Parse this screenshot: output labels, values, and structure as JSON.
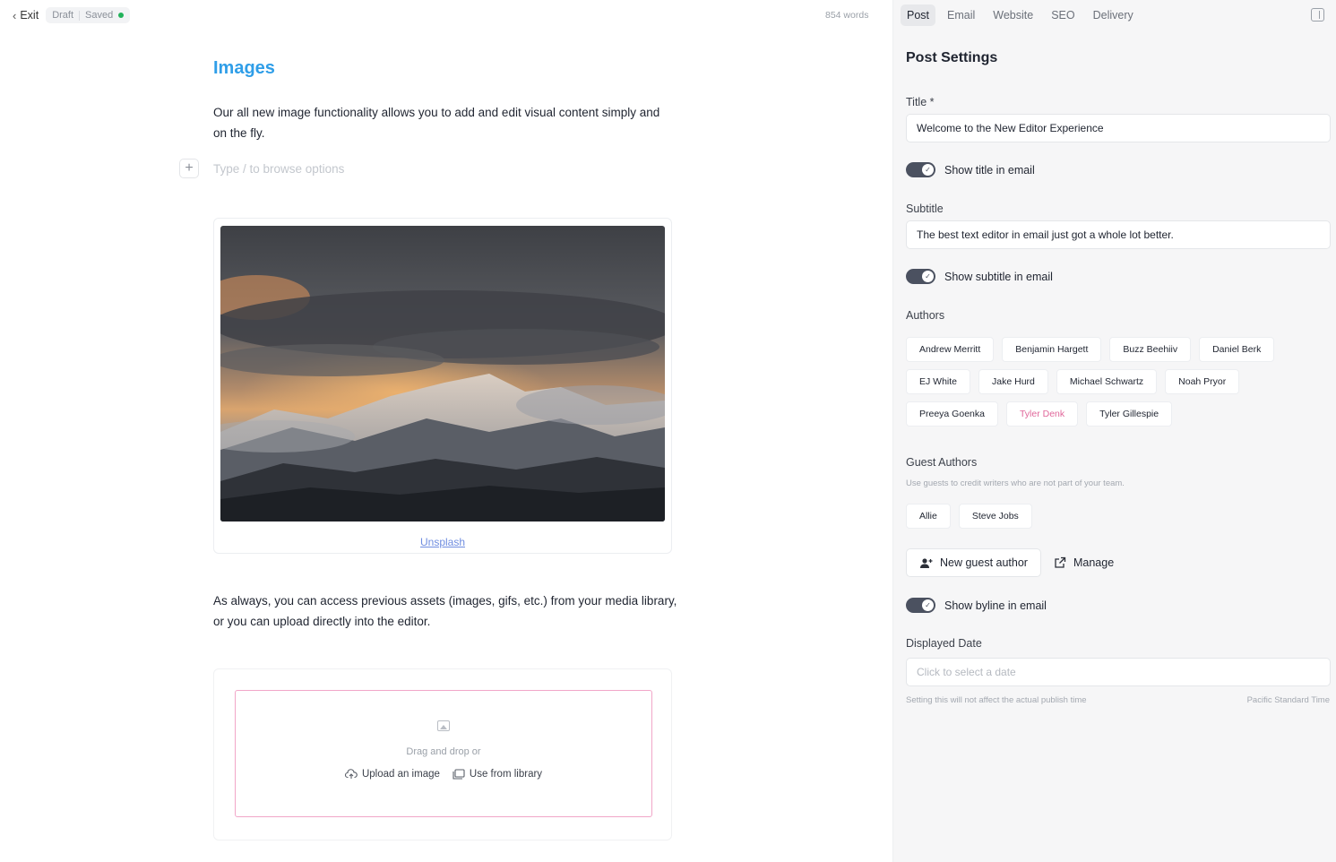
{
  "editor": {
    "exit_label": "Exit",
    "status_draft": "Draft",
    "status_saved": "Saved",
    "word_count": "854 words",
    "heading": "Images",
    "paragraph1": "Our all new image functionality allows you to add and edit visual content simply and on the fly.",
    "type_placeholder": "Type  /  to browse options",
    "image_caption": "Unsplash",
    "paragraph2": "As always, you can access previous assets (images, gifs, etc.) from your media library, or you can upload directly into the editor.",
    "dropzone_text": "Drag and drop or",
    "upload_label": "Upload an image",
    "library_label": "Use from library"
  },
  "sidebar": {
    "tabs": [
      {
        "label": "Post",
        "active": true
      },
      {
        "label": "Email",
        "active": false
      },
      {
        "label": "Website",
        "active": false
      },
      {
        "label": "SEO",
        "active": false
      },
      {
        "label": "Delivery",
        "active": false
      }
    ],
    "title": "Post Settings",
    "title_label": "Title *",
    "title_value": "Welcome to the New Editor Experience",
    "show_title_label": "Show title in email",
    "subtitle_label": "Subtitle",
    "subtitle_value": "The best text editor in email just got a whole lot better.",
    "show_subtitle_label": "Show subtitle in email",
    "authors_label": "Authors",
    "authors": [
      {
        "name": "Andrew Merritt",
        "selected": false
      },
      {
        "name": "Benjamin Hargett",
        "selected": false
      },
      {
        "name": "Buzz Beehiiv",
        "selected": false
      },
      {
        "name": "Daniel Berk",
        "selected": false
      },
      {
        "name": "EJ White",
        "selected": false
      },
      {
        "name": "Jake Hurd",
        "selected": false
      },
      {
        "name": "Michael Schwartz",
        "selected": false
      },
      {
        "name": "Noah Pryor",
        "selected": false
      },
      {
        "name": "Preeya Goenka",
        "selected": false
      },
      {
        "name": "Tyler Denk",
        "selected": true
      },
      {
        "name": "Tyler Gillespie",
        "selected": false
      }
    ],
    "guest_authors_label": "Guest Authors",
    "guest_authors_help": "Use guests to credit writers who are not part of your team.",
    "guest_authors": [
      "Allie",
      "Steve Jobs"
    ],
    "new_guest_label": "New guest author",
    "manage_label": "Manage",
    "show_byline_label": "Show byline in email",
    "displayed_date_label": "Displayed Date",
    "date_placeholder": "Click to select a date",
    "date_help": "Setting this will not affect the actual publish time",
    "timezone": "Pacific Standard Time"
  },
  "colors": {
    "heading_blue": "#2f9ee8",
    "selected_pink": "#e0679a",
    "saved_green": "#22b25a"
  }
}
